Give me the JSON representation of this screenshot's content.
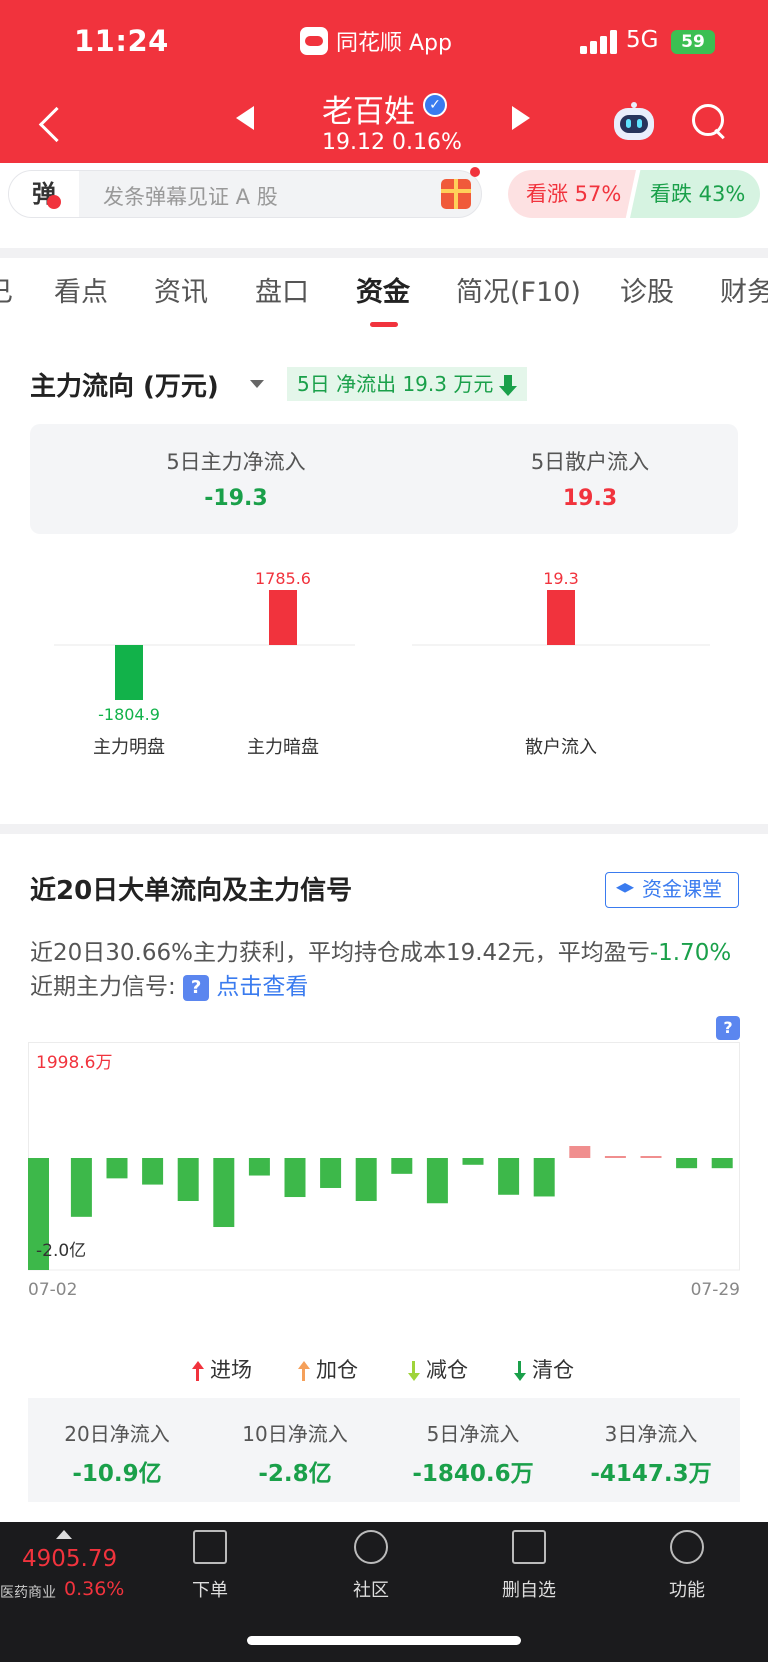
{
  "status": {
    "time": "11:24",
    "app_name": "同花顺 App",
    "network": "5G",
    "battery": "59"
  },
  "header": {
    "stock_name": "老百姓",
    "price_line": "19.12 0.16%"
  },
  "danmaku": {
    "badge": "弹",
    "placeholder": "发条弹幕见证 A 股"
  },
  "sentiment": {
    "bull": "看涨 57%",
    "bear": "看跌 43%"
  },
  "tabs": [
    {
      "label": "已"
    },
    {
      "label": "看点"
    },
    {
      "label": "资讯"
    },
    {
      "label": "盘口"
    },
    {
      "label": "资金"
    },
    {
      "label": "简况(F10)"
    },
    {
      "label": "诊股"
    },
    {
      "label": "财务"
    }
  ],
  "main_flow": {
    "title": "主力流向 (万元)",
    "badge": "5日 净流出 19.3 万元",
    "summary": [
      {
        "label": "5日主力净流入",
        "value": "-19.3"
      },
      {
        "label": "5日散户流入",
        "value": "19.3"
      }
    ]
  },
  "chart_data": [
    {
      "type": "bar",
      "categories": [
        "主力明盘",
        "主力暗盘",
        "散户流入"
      ],
      "values": [
        -1804.9,
        1785.6,
        19.3
      ],
      "data_labels": [
        "-1804.9",
        "1785.6",
        "19.3"
      ],
      "colors": {
        "positive": "#f1333d",
        "negative": "#12b24a"
      }
    },
    {
      "type": "bar",
      "title": "近20日大单流向及主力信号",
      "x_start": "07-02",
      "x_end": "07-29",
      "max_label": "1998.6万",
      "min_label": "-2.0亿",
      "values": [
        -19800,
        -10400,
        -3600,
        -4700,
        -7600,
        -12200,
        -3100,
        -6900,
        -5300,
        -7600,
        -2800,
        -8000,
        -1200,
        -6500,
        -6800,
        2000,
        200,
        200,
        -1800,
        -1800
      ],
      "colors": {
        "positive": "#f08e8e",
        "negative": "#3db84a"
      }
    }
  ],
  "section20": {
    "title": "近20日大单流向及主力信号",
    "course_button": "资金课堂",
    "desc_part1": "近20日30.66%主力获利，平均持仓成本19.42元，平均盈亏",
    "desc_pct": "-1.70%",
    "desc_part2": " 近期主力信号:",
    "desc_link": "点击查看"
  },
  "legend": [
    {
      "label": "进场",
      "color": "#f1333d",
      "dir": "up"
    },
    {
      "label": "加仓",
      "color": "#f5a05a",
      "dir": "up"
    },
    {
      "label": "减仓",
      "color": "#9fd43a",
      "dir": "down"
    },
    {
      "label": "清仓",
      "color": "#1aa04a",
      "dir": "down"
    }
  ],
  "net_inflows": [
    {
      "label": "20日净流入",
      "value": "-10.9亿"
    },
    {
      "label": "10日净流入",
      "value": "-2.8亿"
    },
    {
      "label": "5日净流入",
      "value": "-1840.6万"
    },
    {
      "label": "3日净流入",
      "value": "-4147.3万"
    }
  ],
  "bottom": {
    "index_value": "4905.79",
    "index_name": "医药商业",
    "index_pct": "0.36%",
    "nav": [
      {
        "label": "下单",
        "icon": "document-icon"
      },
      {
        "label": "社区",
        "icon": "star-badge-icon"
      },
      {
        "label": "删自选",
        "icon": "minus-box-icon"
      },
      {
        "label": "功能",
        "icon": "menu-circle-icon"
      }
    ]
  }
}
